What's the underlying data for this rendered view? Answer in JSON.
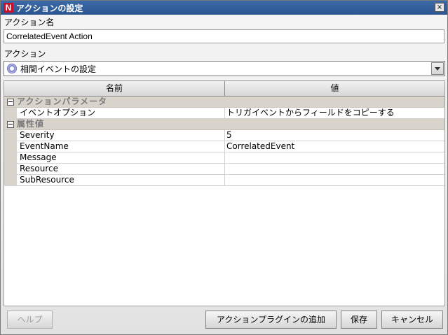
{
  "window": {
    "title": "アクションの設定",
    "logo_letter": "N",
    "close_glyph": "×"
  },
  "action_name": {
    "label": "アクション名",
    "value": "CorrelatedEvent Action"
  },
  "action": {
    "label": "アクション",
    "selected": "相関イベントの設定",
    "icon": "gear-icon"
  },
  "table": {
    "headers": {
      "name": "名前",
      "value": "値"
    },
    "groups": [
      {
        "label": "アクションパラメータ",
        "rows": [
          {
            "name": "イベントオプション",
            "value": "トリガイベントからフィールドをコピーする"
          }
        ]
      },
      {
        "label": "属性値",
        "rows": [
          {
            "name": "Severity",
            "value": "5"
          },
          {
            "name": "EventName",
            "value": "CorrelatedEvent"
          },
          {
            "name": "Message",
            "value": ""
          },
          {
            "name": "Resource",
            "value": ""
          },
          {
            "name": "SubResource",
            "value": ""
          }
        ]
      }
    ]
  },
  "buttons": {
    "help": "ヘルプ",
    "add_plugin": "アクションプラグインの追加",
    "save": "保存",
    "cancel": "キャンセル"
  },
  "colors": {
    "title_bar": "#2e5a96",
    "logo": "#c8102e",
    "group_row": "#d8d4cc"
  }
}
